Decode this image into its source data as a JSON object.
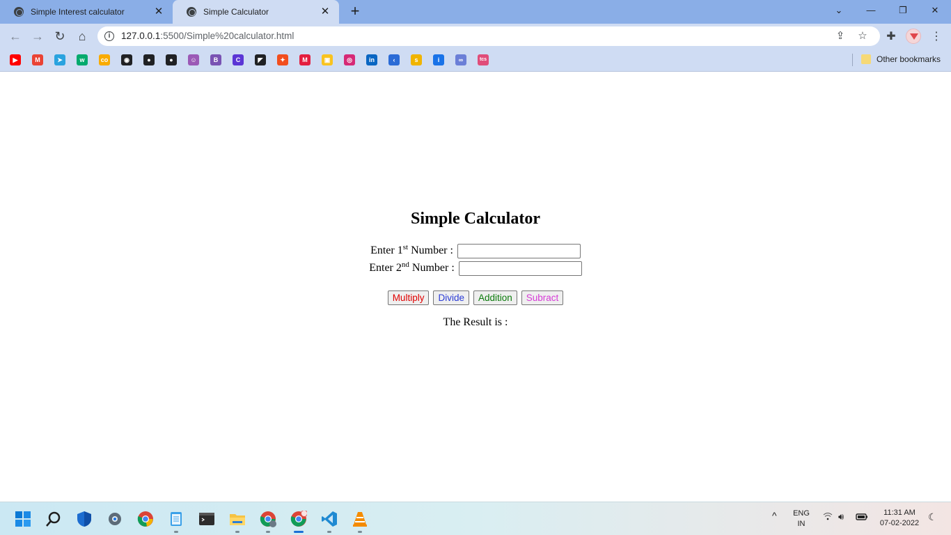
{
  "browser": {
    "tabs": [
      {
        "title": "Simple Interest calculator",
        "active": false
      },
      {
        "title": "Simple Calculator",
        "active": true
      }
    ],
    "close_glyph": "✕",
    "new_tab_glyph": "+",
    "window_controls": {
      "tabs_menu": "⌄",
      "minimize": "—",
      "restore": "❐",
      "close": "✕"
    },
    "nav": {
      "back": "←",
      "forward": "→",
      "reload": "↻",
      "home": "⌂"
    },
    "url_host": "127.0.0.1",
    "url_rest": ":5500/Simple%20calculator.html",
    "bookmarks_other_label": "Other bookmarks",
    "bookmark_icons": [
      {
        "name": "youtube-icon",
        "color": "#ff0000",
        "glyph": "▶"
      },
      {
        "name": "gmail-icon",
        "color": "#ea4335",
        "glyph": "M"
      },
      {
        "name": "telegram-icon",
        "color": "#2aa3df",
        "glyph": "➤"
      },
      {
        "name": "w3-icon",
        "color": "#04aa6d",
        "glyph": "w"
      },
      {
        "name": "colab-icon",
        "color": "#f9ab00",
        "glyph": "co"
      },
      {
        "name": "globe-icon",
        "color": "#202124",
        "glyph": "◉"
      },
      {
        "name": "github-icon",
        "color": "#202124",
        "glyph": "●"
      },
      {
        "name": "github-icon-2",
        "color": "#202124",
        "glyph": "●"
      },
      {
        "name": "avatar-bookmark-icon",
        "color": "#9b59b6",
        "glyph": "☺"
      },
      {
        "name": "bootstrap-icon",
        "color": "#7952b3",
        "glyph": "B"
      },
      {
        "name": "canva-icon",
        "color": "#5b35d5",
        "glyph": "C"
      },
      {
        "name": "dark-square-icon",
        "color": "#202124",
        "glyph": "◤"
      },
      {
        "name": "figma-icon",
        "color": "#f24e1e",
        "glyph": "✦"
      },
      {
        "name": "red-m-icon",
        "color": "#e41e3f",
        "glyph": "M"
      },
      {
        "name": "keep-icon",
        "color": "#f9c31f",
        "glyph": "▣"
      },
      {
        "name": "instagram-icon",
        "color": "#d62976",
        "glyph": "◎"
      },
      {
        "name": "linkedin-icon",
        "color": "#0a66c2",
        "glyph": "in"
      },
      {
        "name": "kotlin-icon",
        "color": "#2b6bd6",
        "glyph": "‹"
      },
      {
        "name": "shine-icon",
        "color": "#f0b400",
        "glyph": "s"
      },
      {
        "name": "info-bookmark-icon",
        "color": "#1a73e8",
        "glyph": "i"
      },
      {
        "name": "swirl-icon",
        "color": "#6b7fd7",
        "glyph": "∞"
      },
      {
        "name": "tcs-icon",
        "color": "#e04d7a",
        "glyph": "tcs"
      }
    ]
  },
  "page": {
    "title": "Simple Calculator",
    "row1_prefix": "Enter 1",
    "row1_sup": "st",
    "row1_suffix": " Number :",
    "row2_prefix": "Enter 2",
    "row2_sup": "nd",
    "row2_suffix": " Number :",
    "input1_value": "",
    "input2_value": "",
    "buttons": [
      {
        "label": "Multiply",
        "color": "#e00000"
      },
      {
        "label": "Divide",
        "color": "#2a3bd6"
      },
      {
        "label": "Addition",
        "color": "#0b7a0b"
      },
      {
        "label": "Subract",
        "color": "#d63ad6"
      }
    ],
    "result_label": "The Result is :",
    "result_value": ""
  },
  "taskbar": {
    "lang_line1": "ENG",
    "lang_line2": "IN",
    "time": "11:31 AM",
    "date": "07-02-2022",
    "chevron": "^",
    "apps": [
      "start-icon",
      "search-icon",
      "defender-icon",
      "settings-icon",
      "chrome-icon",
      "notepad-icon",
      "terminal-icon",
      "file-explorer-icon",
      "chrome-profile-icon",
      "chrome-active-icon",
      "vscode-icon",
      "vlc-icon"
    ]
  }
}
